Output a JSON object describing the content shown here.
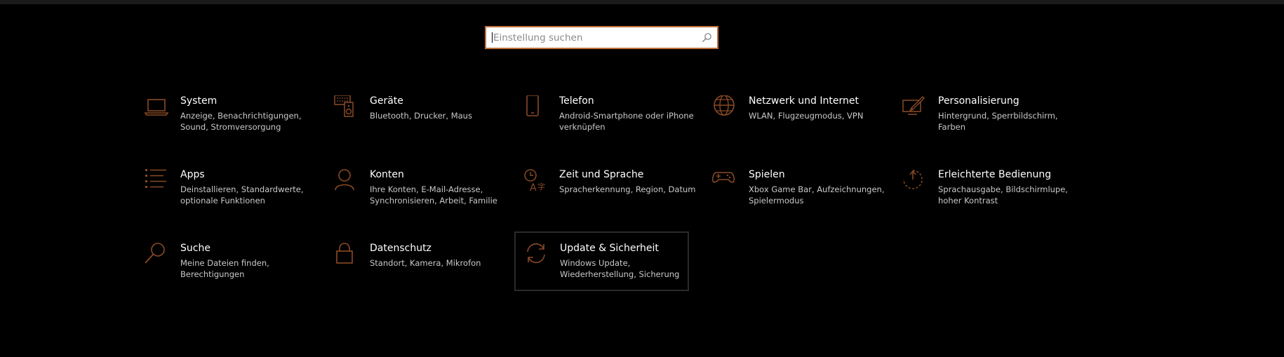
{
  "colors": {
    "accent": "#8a4a25",
    "icon": "#8a4a25",
    "background": "#000000",
    "text": "#ffffff",
    "subtext": "#c9c9c9"
  },
  "search": {
    "placeholder": "Einstellung suchen",
    "icon": "search-icon"
  },
  "tiles": [
    {
      "title": "System",
      "desc": "Anzeige, Benachrichtigungen, Sound, Stromversorgung",
      "icon": "laptop-icon"
    },
    {
      "title": "Geräte",
      "desc": "Bluetooth, Drucker, Maus",
      "icon": "devices-icon"
    },
    {
      "title": "Telefon",
      "desc": "Android-Smartphone oder iPhone verknüpfen",
      "icon": "phone-icon"
    },
    {
      "title": "Netzwerk und Internet",
      "desc": "WLAN, Flugzeugmodus, VPN",
      "icon": "globe-icon"
    },
    {
      "title": "Personalisierung",
      "desc": "Hintergrund, Sperrbildschirm, Farben",
      "icon": "paint-icon"
    },
    {
      "title": "Apps",
      "desc": "Deinstallieren, Standardwerte, optionale Funktionen",
      "icon": "apps-list-icon"
    },
    {
      "title": "Konten",
      "desc": "Ihre Konten, E-Mail-Adresse, Synchronisieren, Arbeit, Familie",
      "icon": "person-icon"
    },
    {
      "title": "Zeit und Sprache",
      "desc": "Spracherkennung, Region, Datum",
      "icon": "time-language-icon"
    },
    {
      "title": "Spielen",
      "desc": "Xbox Game Bar, Aufzeichnungen, Spielermodus",
      "icon": "gamepad-icon"
    },
    {
      "title": "Erleichterte Bedienung",
      "desc": "Sprachausgabe, Bildschirmlupe, hoher Kontrast",
      "icon": "ease-of-access-icon"
    },
    {
      "title": "Suche",
      "desc": "Meine Dateien finden, Berechtigungen",
      "icon": "magnifier-icon"
    },
    {
      "title": "Datenschutz",
      "desc": "Standort, Kamera, Mikrofon",
      "icon": "lock-icon"
    },
    {
      "title": "Update & Sicherheit",
      "desc": "Windows Update, Wiederherstellung, Sicherung",
      "icon": "sync-icon"
    }
  ]
}
